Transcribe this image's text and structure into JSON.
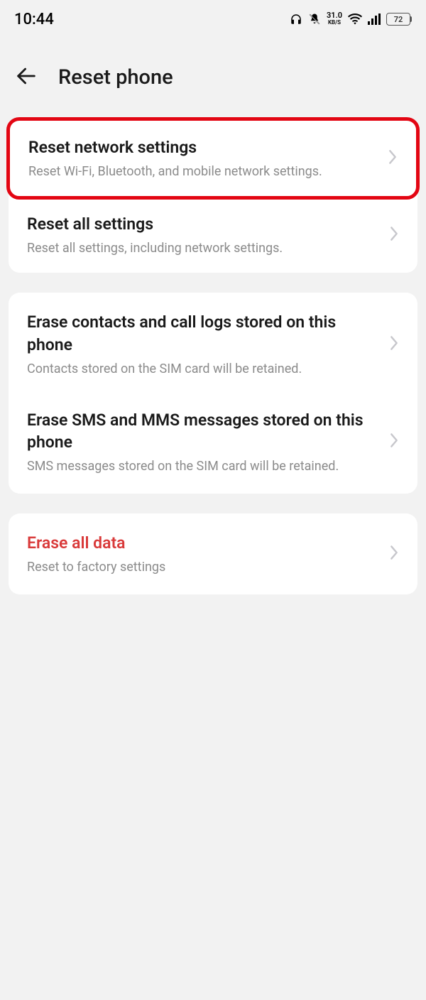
{
  "status": {
    "time": "10:44",
    "net_speed_value": "31.0",
    "net_speed_unit": "KB/S",
    "battery_pct": "72"
  },
  "header": {
    "title": "Reset phone"
  },
  "group1": {
    "items": [
      {
        "title": "Reset network settings",
        "subtitle": "Reset Wi-Fi, Bluetooth, and mobile network settings."
      },
      {
        "title": "Reset all settings",
        "subtitle": "Reset all settings, including network settings."
      }
    ]
  },
  "group2": {
    "items": [
      {
        "title": "Erase contacts and call logs stored on this phone",
        "subtitle": "Contacts stored on the SIM card will be retained."
      },
      {
        "title": "Erase SMS and MMS messages stored on this phone",
        "subtitle": "SMS messages stored on the SIM card will be retained."
      }
    ]
  },
  "group3": {
    "items": [
      {
        "title": "Erase all data",
        "subtitle": "Reset to factory settings"
      }
    ]
  }
}
